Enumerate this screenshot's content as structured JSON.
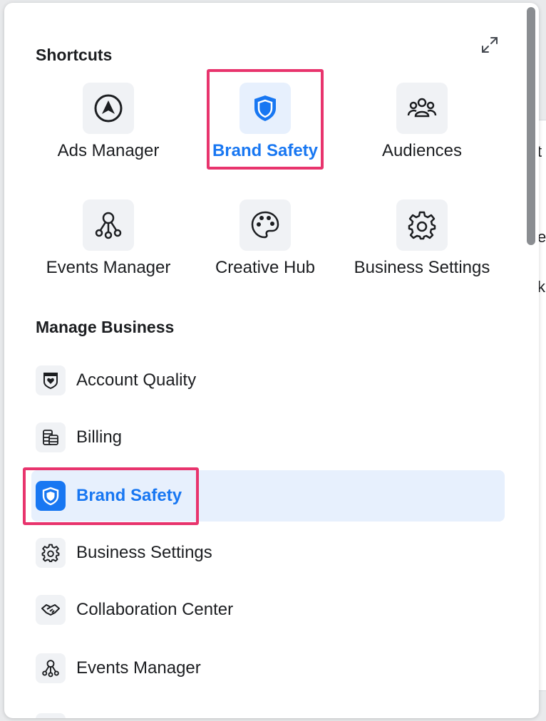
{
  "background_peek": {
    "line1": "t",
    "line2": "e",
    "line3": "k"
  },
  "shortcuts": {
    "title": "Shortcuts",
    "items": [
      {
        "label": "Ads Manager",
        "icon": "navigation-arrow-icon",
        "active": false
      },
      {
        "label": "Brand Safety",
        "icon": "shield-icon",
        "active": true
      },
      {
        "label": "Audiences",
        "icon": "people-group-icon",
        "active": false
      },
      {
        "label": "Events Manager",
        "icon": "nodes-network-icon",
        "active": false
      },
      {
        "label": "Creative Hub",
        "icon": "palette-icon",
        "active": false
      },
      {
        "label": "Business Settings",
        "icon": "gear-icon",
        "active": false
      }
    ]
  },
  "manage_business": {
    "title": "Manage Business",
    "items": [
      {
        "label": "Account Quality",
        "icon": "shield-heart-icon",
        "active": false
      },
      {
        "label": "Billing",
        "icon": "database-stack-icon",
        "active": false
      },
      {
        "label": "Brand Safety",
        "icon": "shield-icon",
        "active": true
      },
      {
        "label": "Business Settings",
        "icon": "gear-icon",
        "active": false
      },
      {
        "label": "Collaboration Center",
        "icon": "handshake-icon",
        "active": false
      },
      {
        "label": "Events Manager",
        "icon": "nodes-network-icon",
        "active": false
      }
    ]
  },
  "colors": {
    "accent": "#1877f2",
    "highlight": "#e8346d",
    "active_bg": "#e7f0fd",
    "tile_bg": "#f0f2f5"
  }
}
